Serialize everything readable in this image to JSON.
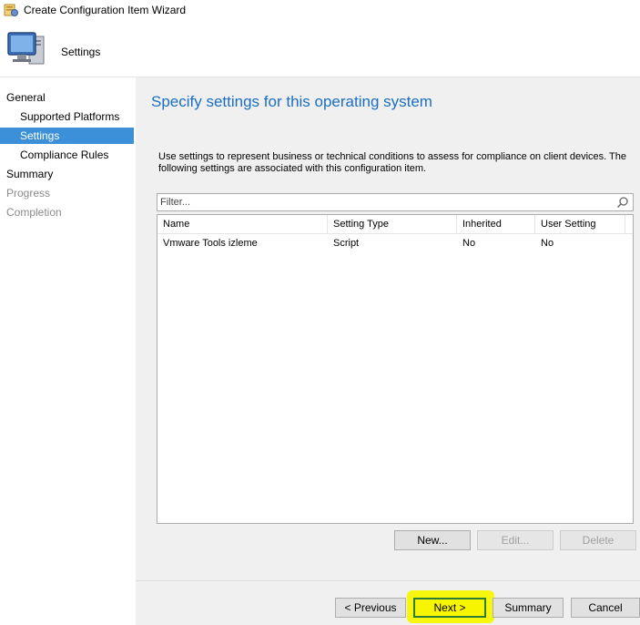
{
  "window": {
    "title": "Create Configuration Item Wizard"
  },
  "header": {
    "title": "Settings"
  },
  "nav": {
    "items": [
      {
        "label": "General",
        "level": 1,
        "state": "normal"
      },
      {
        "label": "Supported Platforms",
        "level": 2,
        "state": "normal"
      },
      {
        "label": "Settings",
        "level": 2,
        "state": "active"
      },
      {
        "label": "Compliance Rules",
        "level": 2,
        "state": "normal"
      },
      {
        "label": "Summary",
        "level": 1,
        "state": "normal"
      },
      {
        "label": "Progress",
        "level": 1,
        "state": "disabled"
      },
      {
        "label": "Completion",
        "level": 1,
        "state": "disabled"
      }
    ]
  },
  "content": {
    "heading": "Specify settings for this operating system",
    "description": "Use settings to represent business or technical conditions to assess for compliance on client devices. The following settings are associated with this configuration item.",
    "filter": {
      "placeholder": "Filter...",
      "value": ""
    },
    "grid": {
      "columns": [
        "Name",
        "Setting Type",
        "Inherited",
        "User Setting"
      ],
      "rows": [
        [
          "Vmware Tools izleme",
          "Script",
          "No",
          "No"
        ]
      ]
    },
    "buttons": {
      "new": "New...",
      "edit": "Edit...",
      "delete": "Delete"
    }
  },
  "footer": {
    "previous": "< Previous",
    "next": "Next >",
    "summary": "Summary",
    "cancel": "Cancel"
  },
  "colors": {
    "accent": "#1b6ec2",
    "nav_active": "#3c8fd9",
    "highlight": "#f7f500"
  },
  "icons": {
    "app": "wizard-app-icon",
    "header": "computer-monitor-icon",
    "search": "search-icon"
  }
}
